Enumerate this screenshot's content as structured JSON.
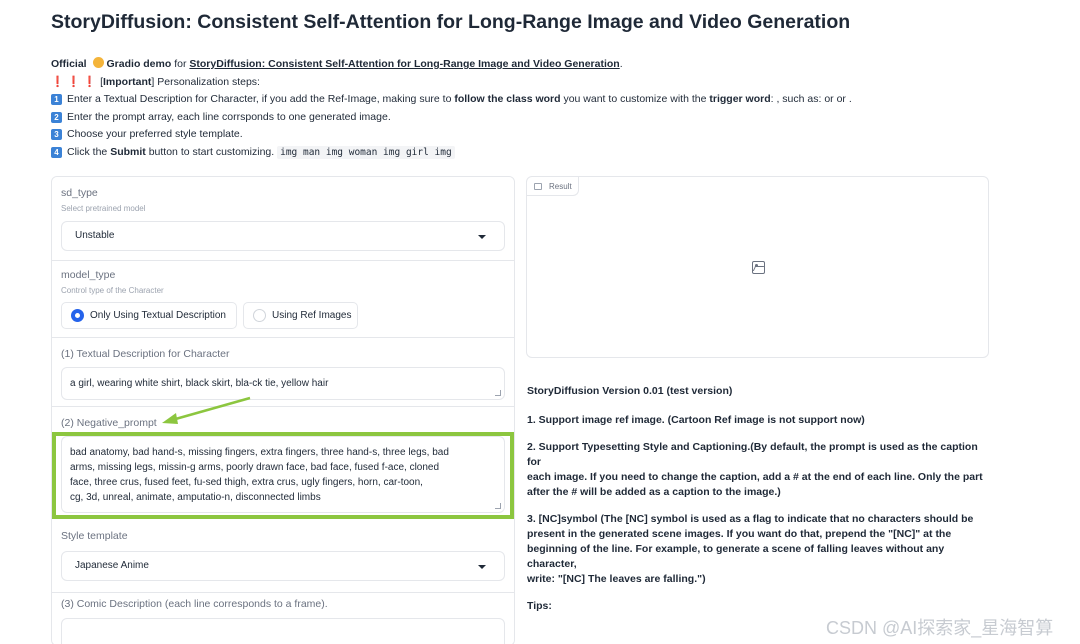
{
  "page": {
    "title": "StoryDiffusion: Consistent Self-Attention for Long-Range Image and Video Generation",
    "intro": {
      "official": "Official",
      "gradio": "Gradio demo",
      "for": "for",
      "link": "StoryDiffusion: Consistent Self-Attention for Long-Range Image and Video Generation",
      "link_end": ".",
      "bangs": "❗ ❗ ❗",
      "important_open": "[",
      "important": "Important",
      "important_rest": "] Personalization steps:",
      "step1_pre": "Enter a Textual Description for Character, if you add the Ref-Image, making sure to",
      "step1_bold1": "follow the class word",
      "step1_mid": "you want to customize with the",
      "step1_bold2": "trigger word",
      "step1_post": ": , such as: or or .",
      "step2": "Enter the prompt array, each line corrsponds to one generated image.",
      "step3": "Choose your preferred style template.",
      "step4_pre": "Click the",
      "step4_bold": "Submit",
      "step4_post": "button to start customizing.",
      "step4_code": "img man img woman img girl img",
      "step_numbers": [
        "1",
        "2",
        "3",
        "4"
      ]
    }
  },
  "form": {
    "sd_type": {
      "label": "sd_type",
      "sublabel": "Select pretrained model",
      "value": "Unstable"
    },
    "model_type": {
      "label": "model_type",
      "sublabel": "Control type of the Character",
      "options": [
        "Only Using Textual Description",
        "Using Ref Images"
      ],
      "selected": "Only Using Textual Description"
    },
    "character": {
      "label": "(1) Textual Description for Character",
      "value": "a girl, wearing white shirt, black skirt, bla-ck tie, yellow hair"
    },
    "negative": {
      "label": "(2) Negative_prompt",
      "lines": [
        "bad anatomy, bad hand-s, missing fingers, extra fingers, three hand-s, three legs, bad",
        "arms, missing legs, missin-g arms, poorly drawn face, bad face, fused f-ace, cloned",
        "face, three crus, fused feet, fu-sed thigh, extra crus, ugly fingers, horn, car-toon,",
        "cg, 3d, unreal, animate, amputatio-n, disconnected limbs"
      ]
    },
    "style": {
      "label": "Style template",
      "value": "Japanese Anime"
    },
    "comic": {
      "label": "(3) Comic Description (each line corresponds to a frame).",
      "value": ""
    }
  },
  "result": {
    "label": "Result"
  },
  "notes": {
    "heading": "StoryDiffusion Version 0.01 (test version)",
    "n1": "1. Support image ref image. (Cartoon Ref image is not support now)",
    "n2_l1": "2. Support Typesetting Style and Captioning.(By default, the prompt is used as the caption for",
    "n2_l2": "each image. If you need to change the caption, add a # at the end of each line. Only the part",
    "n2_l3": "after the # will be added as a caption to the image.)",
    "n3_l1": "3. [NC]symbol (The [NC] symbol is used as a flag to indicate that no characters should be",
    "n3_l2": "present in the generated scene images. If you want do that, prepend the \"[NC]\" at the",
    "n3_l3": "beginning of the line. For example, to generate a scene of falling leaves without any character,",
    "n3_l4": "write: \"[NC] The leaves are falling.\")",
    "tips": "Tips:"
  },
  "watermark": "CSDN @AI探索家_星海智算",
  "colors": {
    "highlight": "#8cc63f",
    "radio_selected": "#2563eb",
    "step_badge": "#3b82d6"
  }
}
